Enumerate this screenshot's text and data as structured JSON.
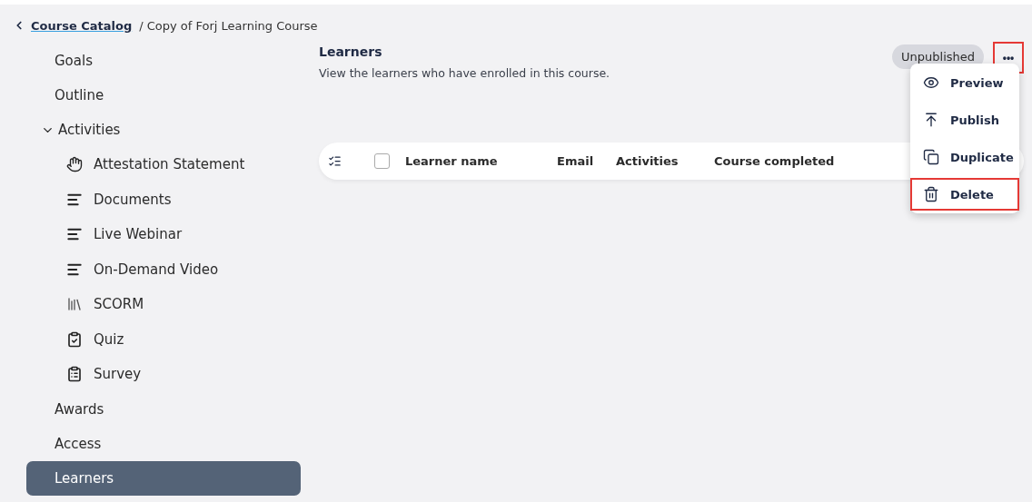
{
  "breadcrumb": {
    "back_link": "Course Catalog",
    "current": "/ Copy of Forj Learning Course"
  },
  "sidebar": {
    "items": [
      {
        "label": "Goals",
        "selected": false
      },
      {
        "label": "Outline",
        "selected": false
      },
      {
        "label": "Activities",
        "selected": false,
        "expanded": true,
        "children": [
          {
            "label": "Attestation Statement",
            "kind": "hand"
          },
          {
            "label": "Documents",
            "kind": "lines"
          },
          {
            "label": "Live Webinar",
            "kind": "lines"
          },
          {
            "label": "On-Demand Video",
            "kind": "lines"
          },
          {
            "label": "SCORM",
            "kind": "stack"
          },
          {
            "label": "Quiz",
            "kind": "checklist"
          },
          {
            "label": "Survey",
            "kind": "notes"
          }
        ]
      },
      {
        "label": "Awards",
        "selected": false
      },
      {
        "label": "Access",
        "selected": false
      },
      {
        "label": "Learners",
        "selected": true
      }
    ]
  },
  "header": {
    "title": "Learners",
    "subtitle": "View the learners who have enrolled in this course.",
    "status": "Unpublished",
    "more_button": {
      "label": "•••",
      "highlighted": true
    }
  },
  "table": {
    "select_all_checked": false,
    "columns": [
      "Learner name",
      "Email",
      "Activities",
      "Course completed"
    ]
  },
  "menu": {
    "items": [
      {
        "label": "Preview",
        "kind": "eye",
        "highlighted": false
      },
      {
        "label": "Publish",
        "kind": "publish",
        "highlighted": false
      },
      {
        "label": "Duplicate",
        "kind": "copy",
        "highlighted": false
      },
      {
        "label": "Delete",
        "kind": "trash",
        "highlighted": true
      }
    ]
  }
}
